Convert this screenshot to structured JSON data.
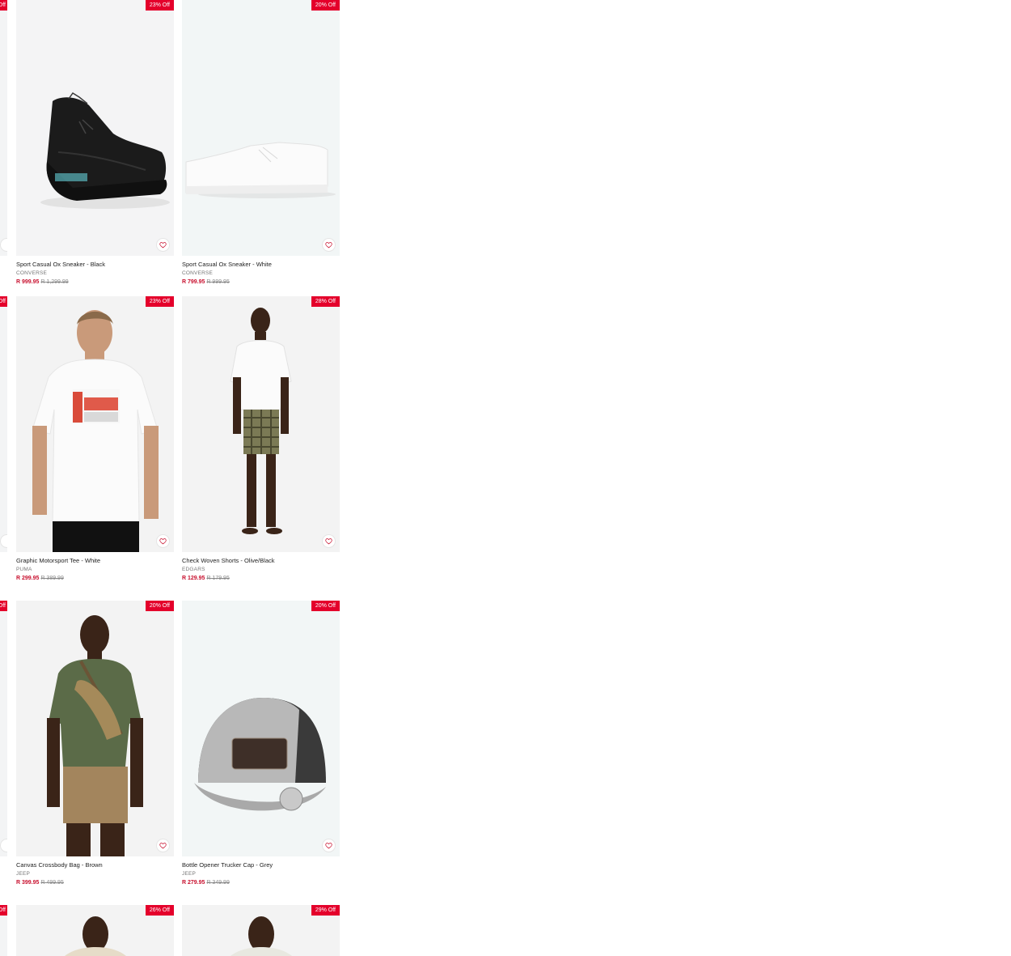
{
  "products": [
    {
      "name": "Sport Casual Ox Sneaker - Black",
      "brand": "CONVERSE",
      "price": "R 999.95",
      "was_price": "R 1,299.99",
      "badge": "23% Off"
    },
    {
      "name": "Sport Casual Ox Sneaker - White",
      "brand": "CONVERSE",
      "price": "R 799.95",
      "was_price": "R 999.95",
      "badge": "20% Off"
    },
    {
      "name": "Graphic Motorsport Tee - White",
      "brand": "PUMA",
      "price": "R 299.95",
      "was_price": "R 389.99",
      "badge": "23% Off"
    },
    {
      "name": "Check Woven Shorts - Olive/Black",
      "brand": "EDGARS",
      "price": "R 129.95",
      "was_price": "R 179.95",
      "badge": "28% Off"
    },
    {
      "name": "Canvas Crossbody Bag - Brown",
      "brand": "JEEP",
      "price": "R 399.95",
      "was_price": "R 499.95",
      "badge": "20% Off"
    },
    {
      "name": "Bottle Opener Trucker Cap - Grey",
      "brand": "JEEP",
      "price": "R 279.95",
      "was_price": "R 349.99",
      "badge": "20% Off"
    },
    {
      "badge": "26% Off"
    },
    {
      "badge": "29% Off"
    }
  ],
  "partial_badge": "Off",
  "colors": {
    "accent": "#e4002b",
    "price": "#c8102e"
  }
}
